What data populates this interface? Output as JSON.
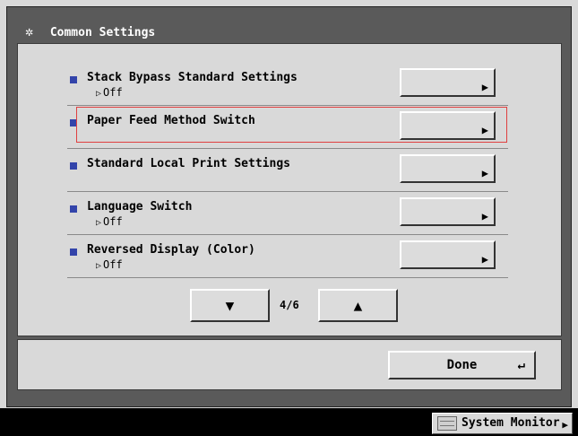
{
  "header": {
    "title": "Common Settings",
    "icon": "gear-settings-icon"
  },
  "rows": [
    {
      "label": "Stack Bypass Standard Settings",
      "value": "Off"
    },
    {
      "label": "Paper Feed Method Switch",
      "value": ""
    },
    {
      "label": "Standard Local Print Settings",
      "value": ""
    },
    {
      "label": "Language Switch",
      "value": "Off"
    },
    {
      "label": "Reversed Display (Color)",
      "value": "Off"
    }
  ],
  "pagination": {
    "current": "4/6"
  },
  "footer": {
    "done_label": "Done"
  },
  "status": {
    "system_monitor_label": "System Monitor"
  },
  "colors": {
    "frame": "#5a5a5a",
    "panel": "#d9d9d9",
    "bullet": "#3344aa",
    "highlight": "#e04040"
  }
}
